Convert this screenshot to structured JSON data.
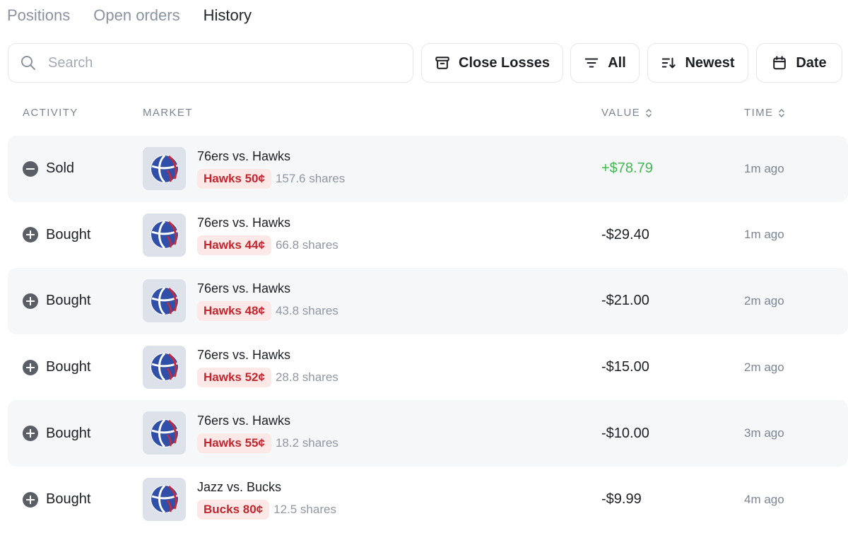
{
  "tabs": [
    {
      "label": "Positions",
      "active": false
    },
    {
      "label": "Open orders",
      "active": false
    },
    {
      "label": "History",
      "active": true
    }
  ],
  "search": {
    "placeholder": "Search",
    "value": ""
  },
  "toolbar": {
    "close_losses_label": "Close Losses",
    "filter_label": "All",
    "sort_label": "Newest",
    "date_label": "Date"
  },
  "table": {
    "headers": {
      "activity": "ACTIVITY",
      "market": "MARKET",
      "value": "VALUE",
      "time": "TIME"
    },
    "rows": [
      {
        "activity": "Sold",
        "activity_icon": "minus-circle-icon",
        "market": "76ers vs. Hawks",
        "outcome": "Hawks 50¢",
        "shares": "157.6 shares",
        "value": "+$78.79",
        "time": "1m ago"
      },
      {
        "activity": "Bought",
        "activity_icon": "plus-circle-icon",
        "market": "76ers vs. Hawks",
        "outcome": "Hawks 44¢",
        "shares": "66.8 shares",
        "value": "-$29.40",
        "time": "1m ago"
      },
      {
        "activity": "Bought",
        "activity_icon": "plus-circle-icon",
        "market": "76ers vs. Hawks",
        "outcome": "Hawks 48¢",
        "shares": "43.8 shares",
        "value": "-$21.00",
        "time": "2m ago"
      },
      {
        "activity": "Bought",
        "activity_icon": "plus-circle-icon",
        "market": "76ers vs. Hawks",
        "outcome": "Hawks 52¢",
        "shares": "28.8 shares",
        "value": "-$15.00",
        "time": "2m ago"
      },
      {
        "activity": "Bought",
        "activity_icon": "plus-circle-icon",
        "market": "76ers vs. Hawks",
        "outcome": "Hawks 55¢",
        "shares": "18.2 shares",
        "value": "-$10.00",
        "time": "3m ago"
      },
      {
        "activity": "Bought",
        "activity_icon": "plus-circle-icon",
        "market": "Jazz vs. Bucks",
        "outcome": "Bucks 80¢",
        "shares": "12.5 shares",
        "value": "-$9.99",
        "time": "4m ago"
      }
    ]
  },
  "colors": {
    "positive_value": "#3fb950",
    "outcome_pill_bg": "#fde8e8",
    "outcome_pill_text": "#c1272d",
    "basketball_blue": "#2f4fa8",
    "basketball_red": "#c8283a"
  }
}
